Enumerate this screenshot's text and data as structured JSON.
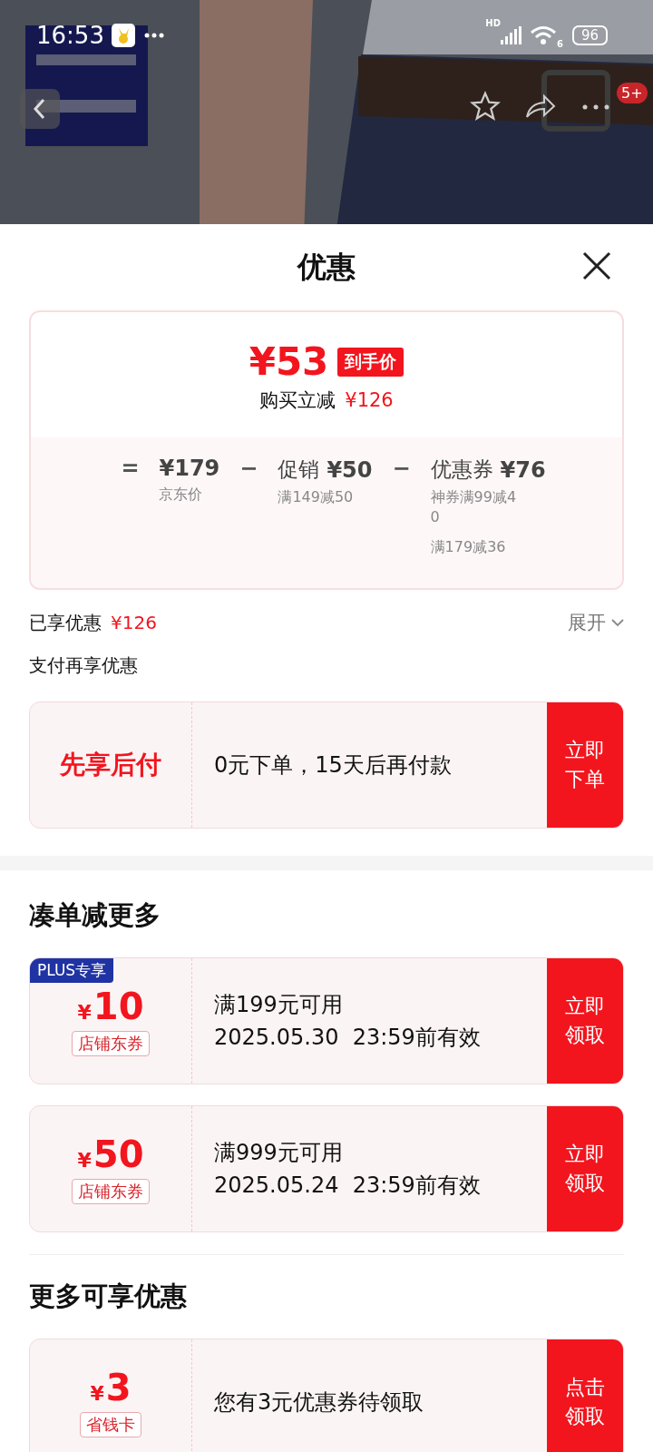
{
  "status_bar": {
    "time": "16:53",
    "network": "HD",
    "wifi_band": "6",
    "battery": "96"
  },
  "nav": {
    "badge": "5+"
  },
  "sheet": {
    "title": "优惠"
  },
  "price_card": {
    "final_price": "¥53",
    "final_tag": "到手价",
    "saving_label": "购买立减",
    "saving_amount": "¥126",
    "breakdown": [
      {
        "operator": "=",
        "amount": "¥179",
        "notes": [
          "京东价"
        ]
      },
      {
        "operator": "−",
        "label": "促销",
        "amount": "¥50",
        "notes": [
          "满149减50"
        ]
      },
      {
        "operator": "−",
        "label": "优惠券",
        "amount": "¥76",
        "notes": [
          "神券满99减40",
          "满179减36"
        ]
      }
    ]
  },
  "enjoyed": {
    "label": "已享优惠",
    "amount": "¥126",
    "toggle": "展开"
  },
  "pay_section": {
    "title": "支付再享优惠",
    "offer": {
      "name": "先享后付",
      "description": "0元下单，15天后再付款",
      "action": "立即下单"
    }
  },
  "bundle_section": {
    "title": "凑单减更多",
    "coupons": [
      {
        "badge": "PLUS专享",
        "currency": "¥",
        "amount": "10",
        "type": "店铺东券",
        "condition": "满199元可用",
        "validity": "2025.05.30  23:59前有效",
        "action": "立即领取"
      },
      {
        "currency": "¥",
        "amount": "50",
        "type": "店铺东券",
        "condition": "满999元可用",
        "validity": "2025.05.24  23:59前有效",
        "action": "立即领取"
      }
    ]
  },
  "more_section": {
    "title": "更多可享优惠",
    "offers": [
      {
        "currency": "¥",
        "amount": "3",
        "type": "省钱卡",
        "description": "您有3元优惠券待领取",
        "action": "点击领取"
      }
    ]
  }
}
